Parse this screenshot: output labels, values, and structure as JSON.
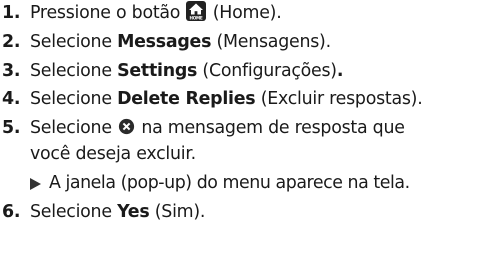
{
  "steps": [
    {
      "number": "1.",
      "before": "Pressione o botão ",
      "icon": "home-button-icon",
      "icon_label": "HOME",
      "after": " (Home)."
    },
    {
      "number": "2.",
      "before": "Selecione ",
      "bold": "Messages",
      "after": " (Mensagens)."
    },
    {
      "number": "3.",
      "before": "Selecione ",
      "bold": "Settings",
      "after": " (Configurações)",
      "bold_tail": "."
    },
    {
      "number": "4.",
      "before": "Selecione ",
      "bold": "Delete Replies",
      "after": " (Excluir respostas)."
    },
    {
      "number": "5.",
      "before": "Selecione ",
      "icon": "delete-circle-x-icon",
      "after": " na mensagem de resposta que",
      "continuation": "você deseja excluir.",
      "result": "A janela (pop-up) do menu aparece na tela.",
      "result_icon": "triangle-arrow-icon"
    },
    {
      "number": "6.",
      "before": "Selecione ",
      "bold": "Yes",
      "after": " (Sim)."
    }
  ]
}
